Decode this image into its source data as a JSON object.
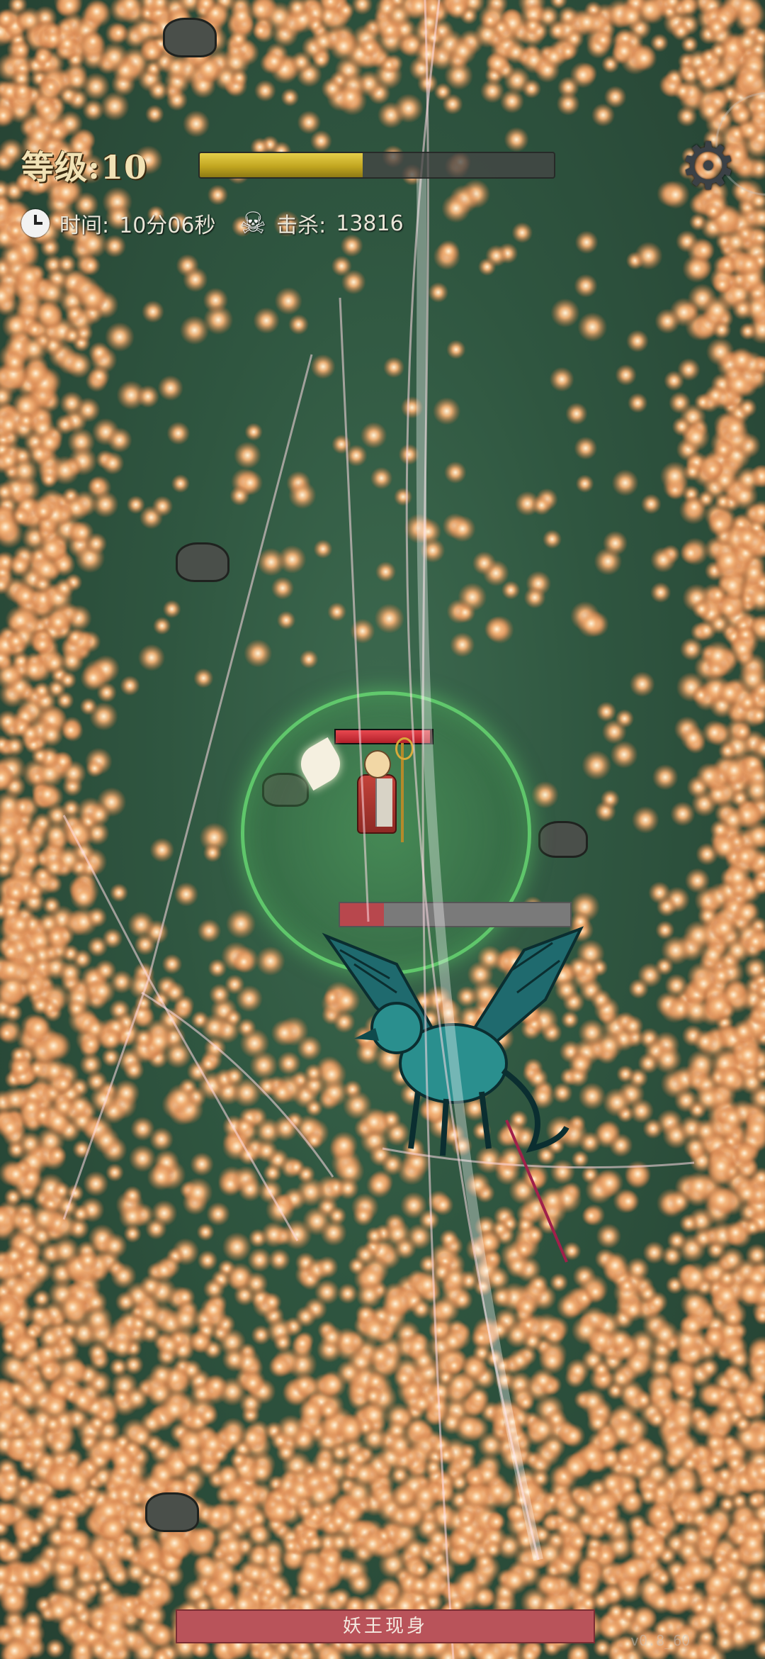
{
  "hud": {
    "level_label": "等级:10",
    "xp_fraction": 0.46,
    "time_label": "时间:",
    "time_value": "10分06秒",
    "kills_label": "击杀:",
    "kills_value": "13816",
    "icons": {
      "clock": "clock-icon",
      "skull": "skull-icon",
      "settings": "gear-icon"
    }
  },
  "player": {
    "hp_fraction": 0.98
  },
  "boss": {
    "hp_fraction": 0.19,
    "banner": "妖王现身"
  },
  "colors": {
    "ground": "#2f5640",
    "swarm": "#f2b277",
    "xp_fill": "#c2a620",
    "aura": "#6ee678",
    "boss_bar": "#b8474d",
    "banner": "#b9535a"
  },
  "footer": {
    "version": "v0.8_60"
  }
}
